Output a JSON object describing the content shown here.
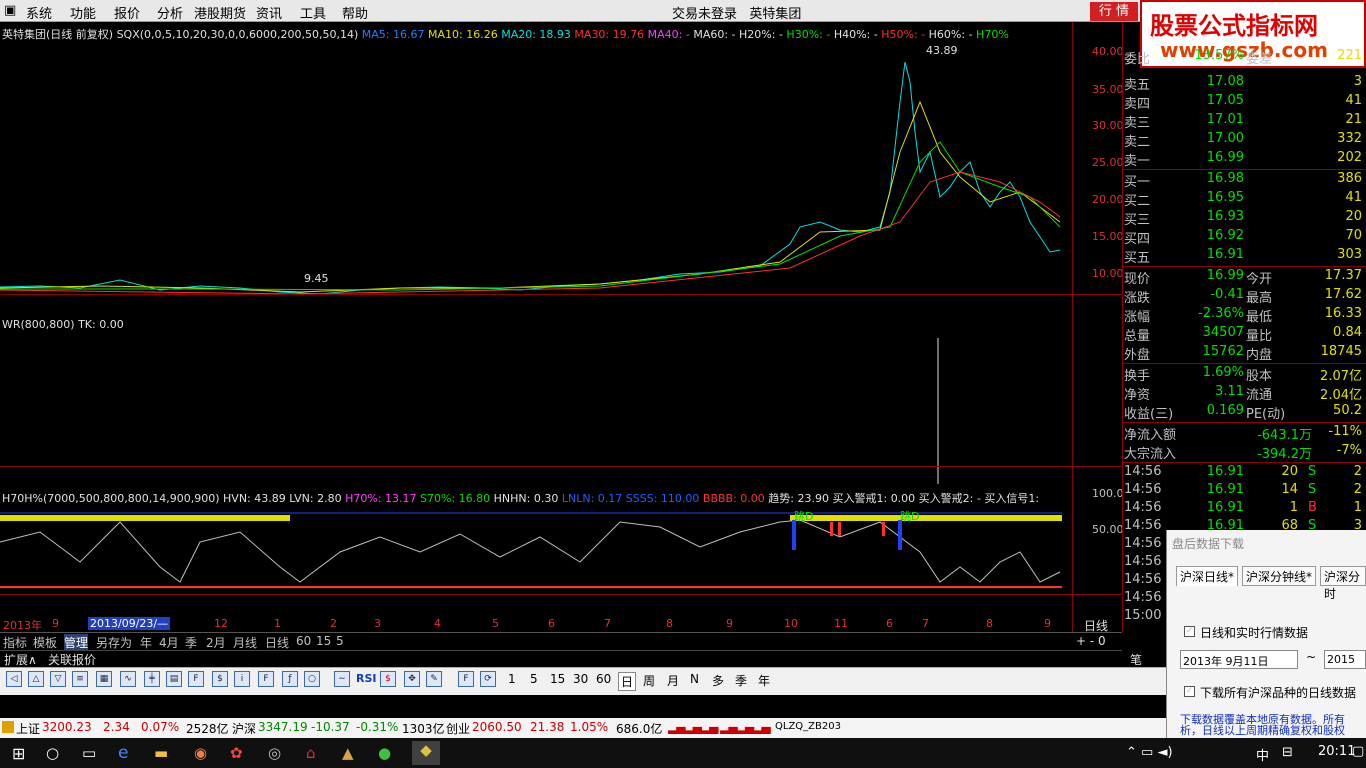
{
  "menubar": {
    "items": [
      "系统",
      "功能",
      "报价",
      "分析",
      "港股期货",
      "资讯",
      "工具",
      "帮助"
    ],
    "login_status": "交易未登录",
    "stock_name": "英特集团",
    "trade_button": "行 情"
  },
  "brand": {
    "line1": "股票公式指标网",
    "line2": "www.gszb.com"
  },
  "main_chart": {
    "header": "英特集团(日线 前复权) SQX(0,0,5,10,20,30,0,0,6000,200,50,50,14)",
    "ma5": "MA5: 16.67",
    "ma10": "MA10: 16.26",
    "ma20": "MA20: 18.93",
    "ma30": "MA30: 19.76",
    "ma40": "MA40: -",
    "ma60": "MA60: -",
    "h20": "H20%: -",
    "h30": "H30%: -",
    "h40": "H40%: -",
    "h50": "H50%: -",
    "h60": "H60%: -",
    "h70": "H70%",
    "high_label": "43.89",
    "low_label": "9.45",
    "y_ticks": [
      "40.00",
      "35.00",
      "30.00",
      "25.00",
      "20.00",
      "15.00",
      "10.00"
    ]
  },
  "wr_panel": {
    "header": "WR(800,800) TK: 0.00"
  },
  "h70_panel": {
    "header_a": "H70H%(7000,500,800,800,14,900,900) HVN: 43.89 LVN: 2.80",
    "header_b": "H70%: 13.17",
    "header_c": "S70%: 16.80",
    "header_d": "HNHN: 0.30",
    "header_e": "LNLN: 0.17",
    "header_f": "SSSS: 110.00",
    "header_g": "BBBB: 0.00",
    "header_h": "趋势: 23.90 买入警戒1: 0.00 买入警戒2: - 买入信号1:",
    "y_ticks": [
      "100.0",
      "50.00"
    ],
    "signal_labels": [
      "跳D",
      "跳D"
    ]
  },
  "time_axis": {
    "labels": [
      "2013年",
      "9",
      "2013/09/23/—",
      "12",
      "1",
      "2",
      "3",
      "4",
      "5",
      "6",
      "7",
      "8",
      "9",
      "10",
      "11",
      "6",
      "7",
      "8",
      "9"
    ],
    "period": "日线"
  },
  "tabs": [
    "指标",
    "模板",
    "管理",
    "另存为",
    "年",
    "4月",
    "季",
    "2月",
    "月线",
    "日线",
    "60",
    "15",
    "5"
  ],
  "ext_row": {
    "left": "扩展∧",
    "right": "关联报价"
  },
  "quote": {
    "top_partial": {
      "k": "委比",
      "v": "13.57%",
      "k2": "委差",
      "n": "221"
    },
    "sell": [
      {
        "k": "卖五",
        "v": "17.08",
        "n": "3"
      },
      {
        "k": "卖四",
        "v": "17.05",
        "n": "41"
      },
      {
        "k": "卖三",
        "v": "17.01",
        "n": "21"
      },
      {
        "k": "卖二",
        "v": "17.00",
        "n": "332"
      },
      {
        "k": "卖一",
        "v": "16.99",
        "n": "202"
      }
    ],
    "buy": [
      {
        "k": "买一",
        "v": "16.98",
        "n": "386"
      },
      {
        "k": "买二",
        "v": "16.95",
        "n": "41"
      },
      {
        "k": "买三",
        "v": "16.93",
        "n": "20"
      },
      {
        "k": "买四",
        "v": "16.92",
        "n": "70"
      },
      {
        "k": "买五",
        "v": "16.91",
        "n": "303"
      }
    ],
    "stats": [
      {
        "k1": "现价",
        "v1": "16.99",
        "k2": "今开",
        "v2": "17.37"
      },
      {
        "k1": "涨跌",
        "v1": "-0.41",
        "k2": "最高",
        "v2": "17.62"
      },
      {
        "k1": "涨幅",
        "v1": "-2.36%",
        "k2": "最低",
        "v2": "16.33"
      },
      {
        "k1": "总量",
        "v1": "34507",
        "k2": "量比",
        "v2": "0.84"
      },
      {
        "k1": "外盘",
        "v1": "15762",
        "k2": "内盘",
        "v2": "18745"
      }
    ],
    "stats2": [
      {
        "k1": "换手",
        "v1": "1.69%",
        "k2": "股本",
        "v2": "2.07亿"
      },
      {
        "k1": "净资",
        "v1": "3.11",
        "k2": "流通",
        "v2": "2.04亿"
      },
      {
        "k1": "收益(三)",
        "v1": "0.169",
        "k2": "PE(动)",
        "v2": "50.2"
      }
    ],
    "flow": [
      {
        "k": "净流入额",
        "v": "-643.1万",
        "p": "-11%"
      },
      {
        "k": "大宗流入",
        "v": "-394.2万",
        "p": "-7%"
      }
    ],
    "ticks": [
      {
        "t": "14:56",
        "p": "16.91",
        "n": "20",
        "s": "S",
        "x": "2"
      },
      {
        "t": "14:56",
        "p": "16.91",
        "n": "14",
        "s": "S",
        "x": "2"
      },
      {
        "t": "14:56",
        "p": "16.91",
        "n": "1",
        "s": "B",
        "x": "1"
      },
      {
        "t": "14:56",
        "p": "16.91",
        "n": "68",
        "s": "S",
        "x": "3"
      },
      {
        "t": "14:56",
        "p": "",
        "n": "",
        "s": "",
        "x": ""
      },
      {
        "t": "14:56",
        "p": "",
        "n": "",
        "s": "",
        "x": ""
      },
      {
        "t": "14:56",
        "p": "",
        "n": "",
        "s": "",
        "x": ""
      },
      {
        "t": "14:56",
        "p": "",
        "n": "",
        "s": "",
        "x": ""
      },
      {
        "t": "15:00",
        "p": "",
        "n": "",
        "s": "",
        "x": ""
      }
    ],
    "bottom_tab": "笔"
  },
  "toolbar": {
    "rsi": "RSI",
    "periods": [
      "1",
      "5",
      "15",
      "30",
      "60"
    ],
    "cycles": [
      "日",
      "周",
      "月",
      "N",
      "多",
      "季",
      "年"
    ]
  },
  "dialog": {
    "title": "盘后数据下载",
    "tabs": [
      "沪深日线*",
      "沪深分钟线*",
      "沪深分时"
    ],
    "check1": "日线和实时行情数据",
    "date_from": "2013年 9月11日",
    "tilde": "~",
    "date_to": "2015年",
    "check2": "下载所有沪深品种的日线数据",
    "note": "下载数据覆盖本地原有数据。所有 析，日线以上周期精确复权和股权"
  },
  "statusbar": {
    "sh_label": "上证",
    "sh_val": "3200.23",
    "sh_chg": "2.34",
    "sh_pct": "0.07%",
    "sh_amt": "2528亿",
    "hs_label": "沪深",
    "hs_val": "3347.19",
    "hs_chg": "-10.37",
    "hs_pct": "-0.31%",
    "hs_amt": "1303亿",
    "cy_label": "创业",
    "cy_val": "2060.50",
    "cy_chg": "21.38",
    "cy_pct": "1.05%",
    "cy_amt": "686.0亿",
    "code": "QLZQ_ZB203"
  },
  "taskbar": {
    "ime": "中",
    "clock": "20:11"
  },
  "colors": {
    "up": "#ff3030",
    "down": "#00e000",
    "frame": "#8b0000",
    "yellow": "#e0e000"
  }
}
